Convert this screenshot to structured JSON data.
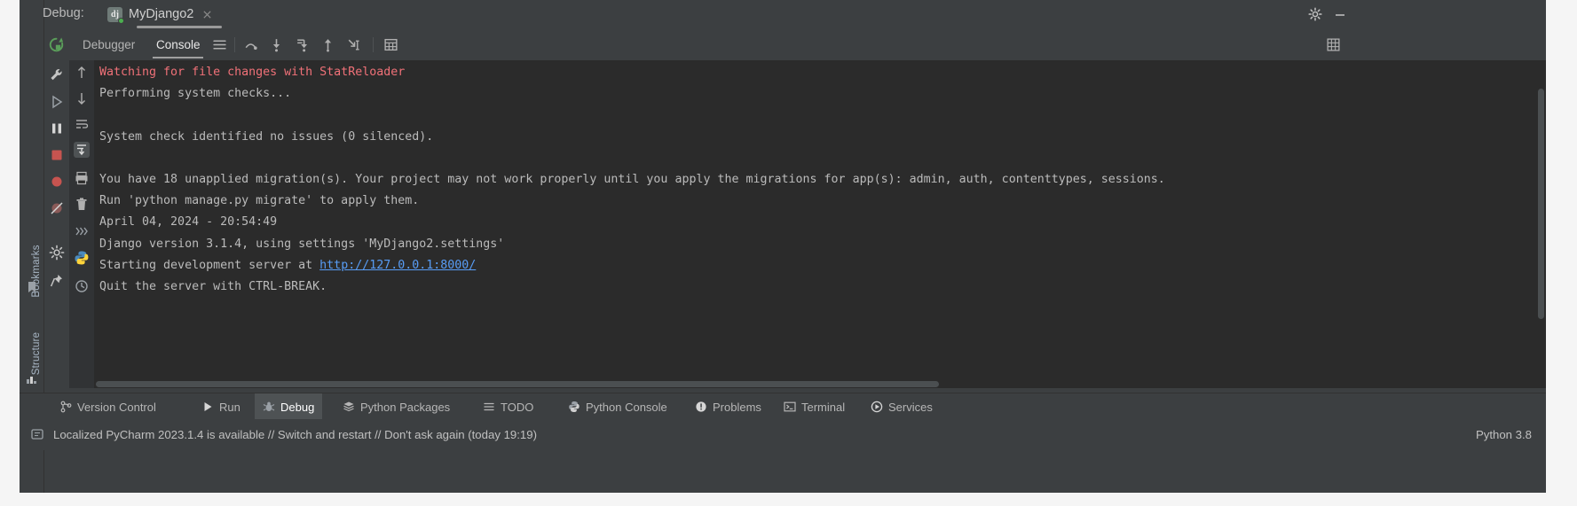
{
  "window": {
    "debug_label": "Debug:",
    "tab_name": "MyDjango2",
    "tab_icon": "django-icon",
    "close_icon": "close-icon",
    "settings_icon": "gear-icon",
    "minimize_icon": "minimize-icon"
  },
  "left_stripe": {
    "bookmarks_label": "Bookmarks",
    "structure_label": "Structure"
  },
  "run_toolbar": {
    "rerun_icon": "rerun-icon",
    "tabs": [
      {
        "label": "Debugger",
        "active": false
      },
      {
        "label": "Console",
        "active": true
      }
    ],
    "icons": [
      "menu-icon",
      "step-over-icon",
      "step-into-icon",
      "force-step-into-icon",
      "step-out-icon",
      "run-to-cursor-icon",
      "evaluate-expression-icon",
      "soft-wrap-icon"
    ]
  },
  "run_gutter_icons": [
    "wrench-icon",
    "resume-icon",
    "pause-icon",
    "stop-icon",
    "view-breakpoints-icon",
    "mute-breakpoints-icon",
    "settings-icon",
    "pin-icon"
  ],
  "console_gutter_icons": [
    "scroll-up-icon",
    "scroll-down-icon",
    "soft-wrap-icon",
    "scroll-to-end-icon",
    "print-icon",
    "clear-all-icon",
    "move-to-console-icon",
    "python-console-icon",
    "history-icon"
  ],
  "console": {
    "lines": [
      {
        "text": "Watching for file changes with StatReloader",
        "style": "red"
      },
      {
        "text": "Performing system checks...",
        "style": "normal"
      },
      {
        "text": "",
        "style": "normal"
      },
      {
        "text": "System check identified no issues (0 silenced).",
        "style": "normal"
      },
      {
        "text": "",
        "style": "normal"
      },
      {
        "text": "You have 18 unapplied migration(s). Your project may not work properly until you apply the migrations for app(s): admin, auth, contenttypes, sessions.",
        "style": "normal"
      },
      {
        "text": "Run 'python manage.py migrate' to apply them.",
        "style": "normal"
      },
      {
        "text": "April 04, 2024 - 20:54:49",
        "style": "normal"
      },
      {
        "text": "Django version 3.1.4, using settings 'MyDjango2.settings'",
        "style": "normal"
      },
      {
        "text": "Starting development server at ",
        "style": "link-prefix",
        "link": "http://127.0.0.1:8000/"
      },
      {
        "text": "Quit the server with CTRL-BREAK.",
        "style": "normal"
      }
    ]
  },
  "bottom_tabs": [
    {
      "label": "Version Control",
      "icon": "version-control-icon",
      "active": false
    },
    {
      "label": "Run",
      "icon": "run-icon",
      "active": false
    },
    {
      "label": "Debug",
      "icon": "debug-icon",
      "active": true
    },
    {
      "label": "Python Packages",
      "icon": "packages-icon",
      "active": false
    },
    {
      "label": "TODO",
      "icon": "todo-icon",
      "active": false
    },
    {
      "label": "Python Console",
      "icon": "python-console-icon",
      "active": false
    },
    {
      "label": "Problems",
      "icon": "problems-icon",
      "active": false
    },
    {
      "label": "Terminal",
      "icon": "terminal-icon",
      "active": false
    },
    {
      "label": "Services",
      "icon": "services-icon",
      "active": false
    }
  ],
  "status_bar": {
    "icon": "notification-icon",
    "message": "Localized PyCharm 2023.1.4 is available // Switch and restart // Don't ask again (today 19:19)",
    "interpreter": "Python 3.8"
  },
  "colors": {
    "background": "#2b2b2b",
    "panel": "#3c3f41",
    "error_text": "#f07178",
    "link": "#589df6",
    "text": "#bbbbbb",
    "accent_green": "#4caf50"
  }
}
